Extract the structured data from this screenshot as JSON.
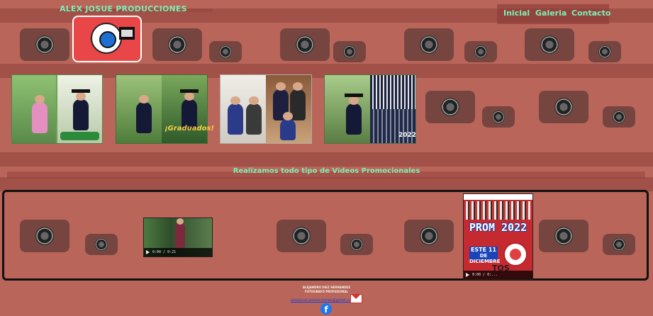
{
  "header": {
    "brand": "ALEX JOSUE PRODUCCIONES",
    "nav": [
      "Inicial",
      "Galeria",
      "Contacto"
    ]
  },
  "gallery": {
    "photos": [
      {
        "caption": ""
      },
      {
        "caption": "¡Graduados!"
      },
      {
        "caption": ""
      },
      {
        "caption": "2022"
      }
    ]
  },
  "tagline": "Realizamos todo tipo de Videos Promocionales",
  "videos": [
    {
      "time": "0:00 / 0:21"
    },
    {
      "title": "PROM 2022",
      "date_day": "ESTE 11",
      "date_month": "DE DICIEMBRE",
      "bottom_text": "TOS",
      "time": "0:00 / 0:..."
    }
  ],
  "footer": {
    "name": "ALEJANDRO DIEZ HERNANDEZ",
    "role": "FOTOGRAFO PROFESIONAL",
    "email": "alexjosue.producciones@gmail.com"
  },
  "colors": {
    "accent": "#7cf0b5",
    "background": "#b9655a"
  }
}
